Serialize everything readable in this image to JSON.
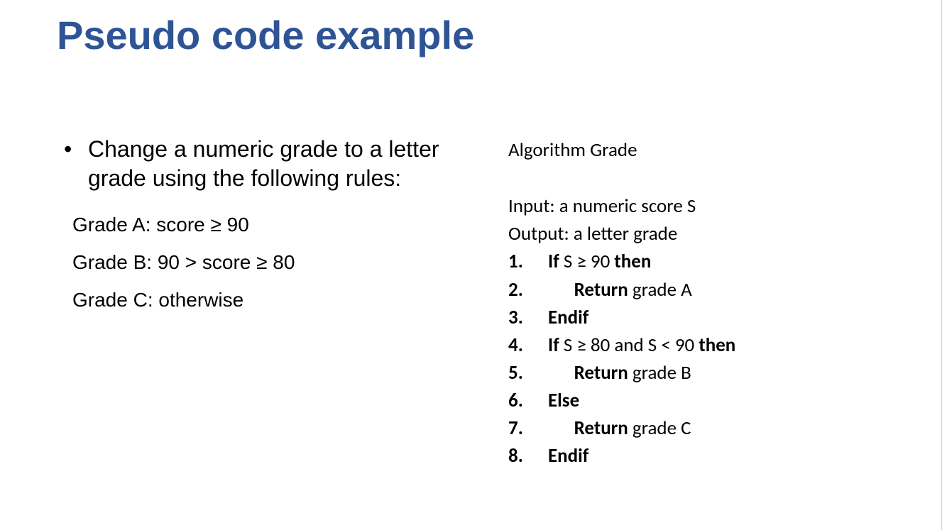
{
  "title": "Pseudo code example",
  "left": {
    "bullet": "Change a numeric grade to a letter grade using the following rules:",
    "rules": [
      "Grade A: score ≥ 90",
      "Grade B:  90 > score ≥ 80",
      "Grade C: otherwise"
    ]
  },
  "right": {
    "algo_title": "Algorithm Grade",
    "input": "Input: a numeric score S",
    "output": "Output: a letter grade",
    "steps": [
      {
        "pre_b": "If ",
        "cond": "S ≥ 90 ",
        "post_b": "then",
        "indent": ""
      },
      {
        "pre_b": "Return ",
        "cond": "grade A",
        "post_b": "",
        "indent": "      "
      },
      {
        "pre_b": "Endif",
        "cond": "",
        "post_b": "",
        "indent": ""
      },
      {
        "pre_b": "If ",
        "cond": "S ≥ 80 and S < 90 ",
        "post_b": "then",
        "indent": ""
      },
      {
        "pre_b": "Return ",
        "cond": "grade B",
        "post_b": "",
        "indent": "      "
      },
      {
        "pre_b": "Else",
        "cond": "",
        "post_b": "",
        "indent": ""
      },
      {
        "pre_b": "Return ",
        "cond": "grade C",
        "post_b": "",
        "indent": "      "
      },
      {
        "pre_b": "Endif",
        "cond": "",
        "post_b": "",
        "indent": ""
      }
    ]
  }
}
